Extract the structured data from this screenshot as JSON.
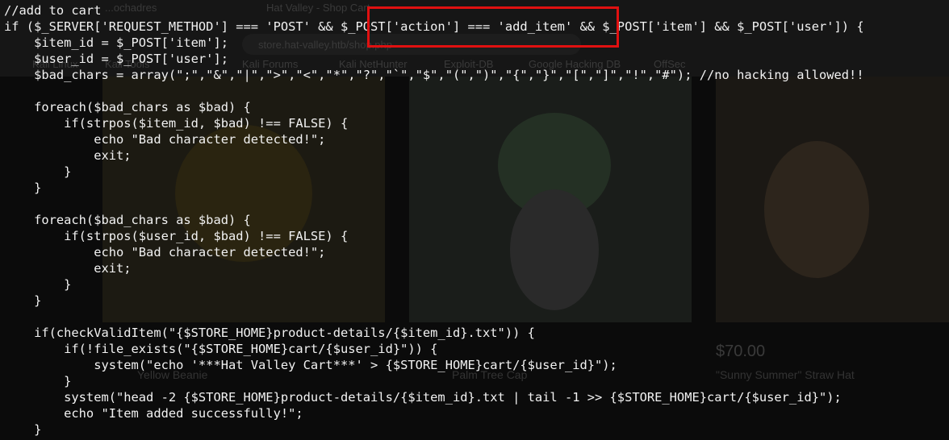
{
  "background_page": {
    "tabs": [
      "...ochadres",
      "Hat Valley - Shop Cart"
    ],
    "url": "store.hat-valley.htb/shop.php",
    "bookmarks": [
      "Kali Linux",
      "Kali Tools",
      "Kali Forums",
      "Kali NetHunter",
      "Exploit-DB",
      "Google Hacking DB",
      "OffSec"
    ],
    "products": [
      {
        "name": "Yellow Beanie",
        "price": ""
      },
      {
        "name": "Palm Tree Cap",
        "price": ""
      },
      {
        "name": "\"Sunny Summer\" Straw Hat",
        "price": "$70.00"
      }
    ]
  },
  "code_lines": [
    "//add to cart",
    "if ($_SERVER['REQUEST_METHOD'] === 'POST' && $_POST['action'] === 'add_item' && $_POST['item'] && $_POST['user']) {",
    "    $item_id = $_POST['item'];",
    "    $user_id = $_POST['user'];",
    "    $bad_chars = array(\";\",\"&\",\"|\",\">\",\"<\",\"*\",\"?\",\"`\",\"$\",\"(\",\")\",\"{\",\"}\",\"[\",\"]\",\"!\",\"#\"); //no hacking allowed!!",
    "",
    "    foreach($bad_chars as $bad) {",
    "        if(strpos($item_id, $bad) !== FALSE) {",
    "            echo \"Bad character detected!\";",
    "            exit;",
    "        }",
    "    }",
    "",
    "    foreach($bad_chars as $bad) {",
    "        if(strpos($user_id, $bad) !== FALSE) {",
    "            echo \"Bad character detected!\";",
    "            exit;",
    "        }",
    "    }",
    "",
    "    if(checkValidItem(\"{$STORE_HOME}product-details/{$item_id}.txt\")) {",
    "        if(!file_exists(\"{$STORE_HOME}cart/{$user_id}\")) {",
    "            system(\"echo '***Hat Valley Cart***' > {$STORE_HOME}cart/{$user_id}\");",
    "        }",
    "        system(\"head -2 {$STORE_HOME}product-details/{$item_id}.txt | tail -1 >> {$STORE_HOME}cart/{$user_id}\");",
    "        echo \"Item added successfully!\";",
    "    }"
  ],
  "highlight_color": "#e01010",
  "text_color": "#f2f2f2",
  "background_color": "#0b0b0b"
}
